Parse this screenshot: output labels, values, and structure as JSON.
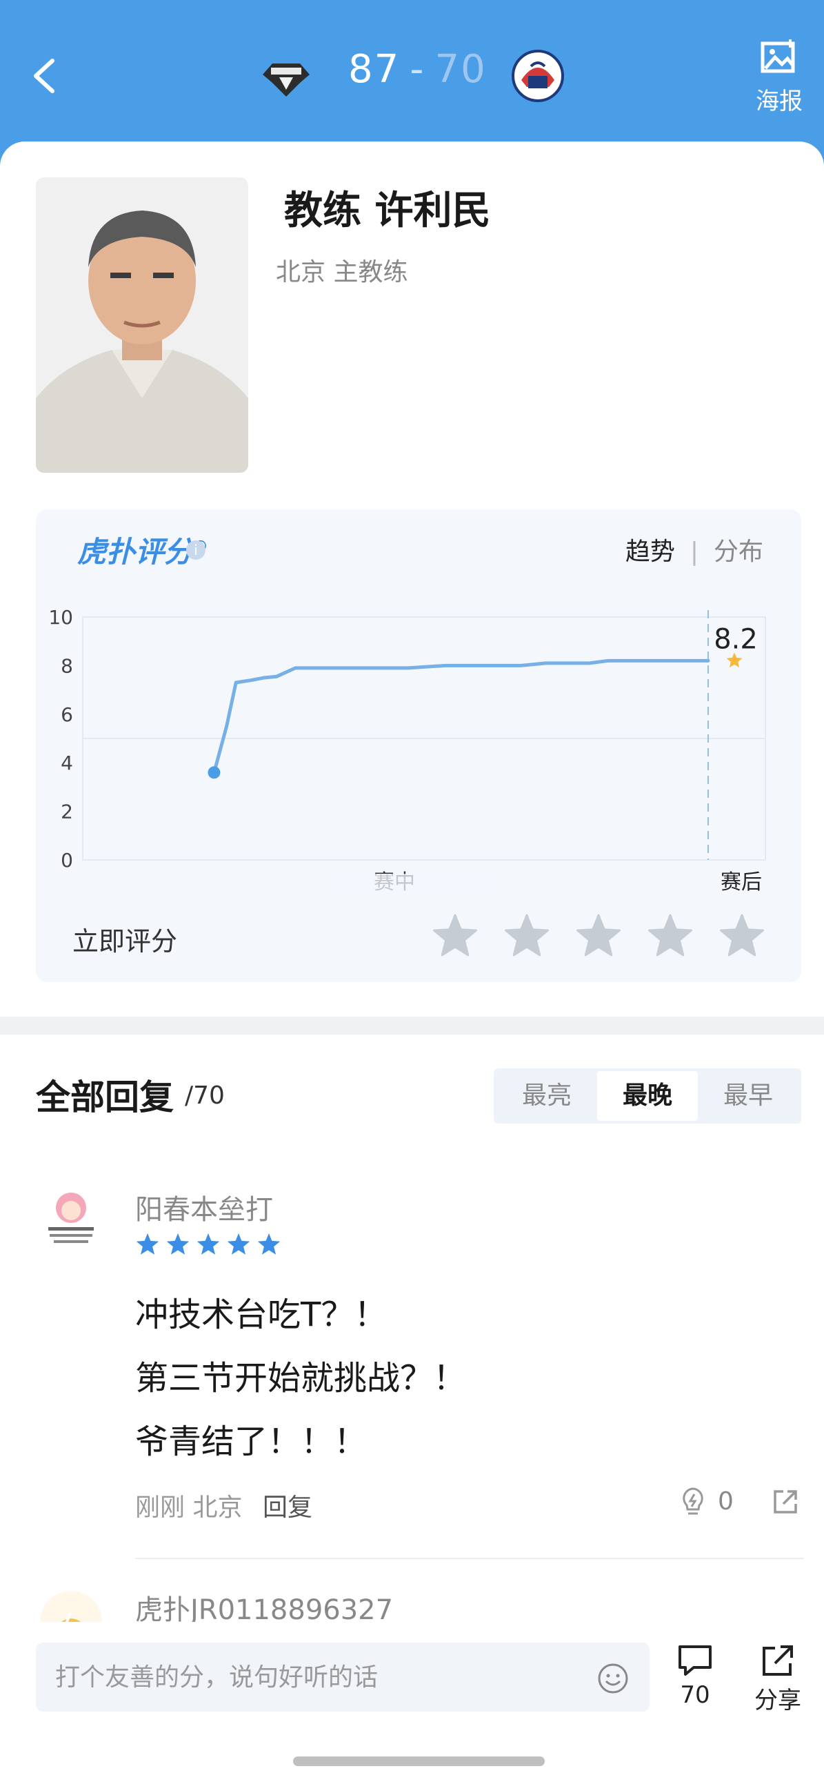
{
  "header": {
    "home_score": "87",
    "separator": "-",
    "away_score": "70",
    "poster_label": "海报",
    "home_logo": "ducks-logo",
    "away_logo": "qingdao-logo"
  },
  "coach": {
    "name": "教练 许利民",
    "role": "北京 主教练"
  },
  "rating": {
    "brand": "虎扑评分",
    "brand_mark": "®",
    "toggle_trend": "趋势",
    "toggle_sep": "|",
    "toggle_dist": "分布",
    "rate_now": "立即评分",
    "star_count": 5
  },
  "chart_data": {
    "type": "line",
    "y_ticks": [
      "10",
      "8",
      "6",
      "4",
      "2",
      "0"
    ],
    "ylim": [
      0,
      10
    ],
    "x_labels": [
      "赛中",
      "赛后"
    ],
    "series": [
      {
        "values": [
          [
            0.21,
            3.6
          ],
          [
            0.23,
            5.5
          ],
          [
            0.245,
            7.3
          ],
          [
            0.27,
            7.4
          ],
          [
            0.29,
            7.5
          ],
          [
            0.31,
            7.55
          ],
          [
            0.34,
            7.9
          ],
          [
            0.48,
            7.9
          ],
          [
            0.52,
            7.9
          ],
          [
            0.58,
            8.0
          ],
          [
            0.7,
            8.0
          ],
          [
            0.74,
            8.1
          ],
          [
            0.81,
            8.1
          ],
          [
            0.84,
            8.2
          ],
          [
            1.0,
            8.2
          ]
        ]
      }
    ],
    "final_value": "8.2",
    "accent": "#76b0e6"
  },
  "replies": {
    "title": "全部回复",
    "count": "/70",
    "sort_tabs": [
      "最亮",
      "最晚",
      "最早"
    ],
    "active_tab": 1
  },
  "comments": [
    {
      "user": "阳春本垒打",
      "stars": 5,
      "lines": [
        "冲技术台吃T？！",
        "第三节开始就挑战？！",
        "爷青结了！！！"
      ],
      "time": "刚刚",
      "location": "北京",
      "reply_label": "回复",
      "likes": "0"
    },
    {
      "user": "虎扑JR0118896327"
    }
  ],
  "bottom_bar": {
    "input_placeholder": "打个友善的分，说句好听的话",
    "comment_count": "70",
    "share_label": "分享"
  }
}
